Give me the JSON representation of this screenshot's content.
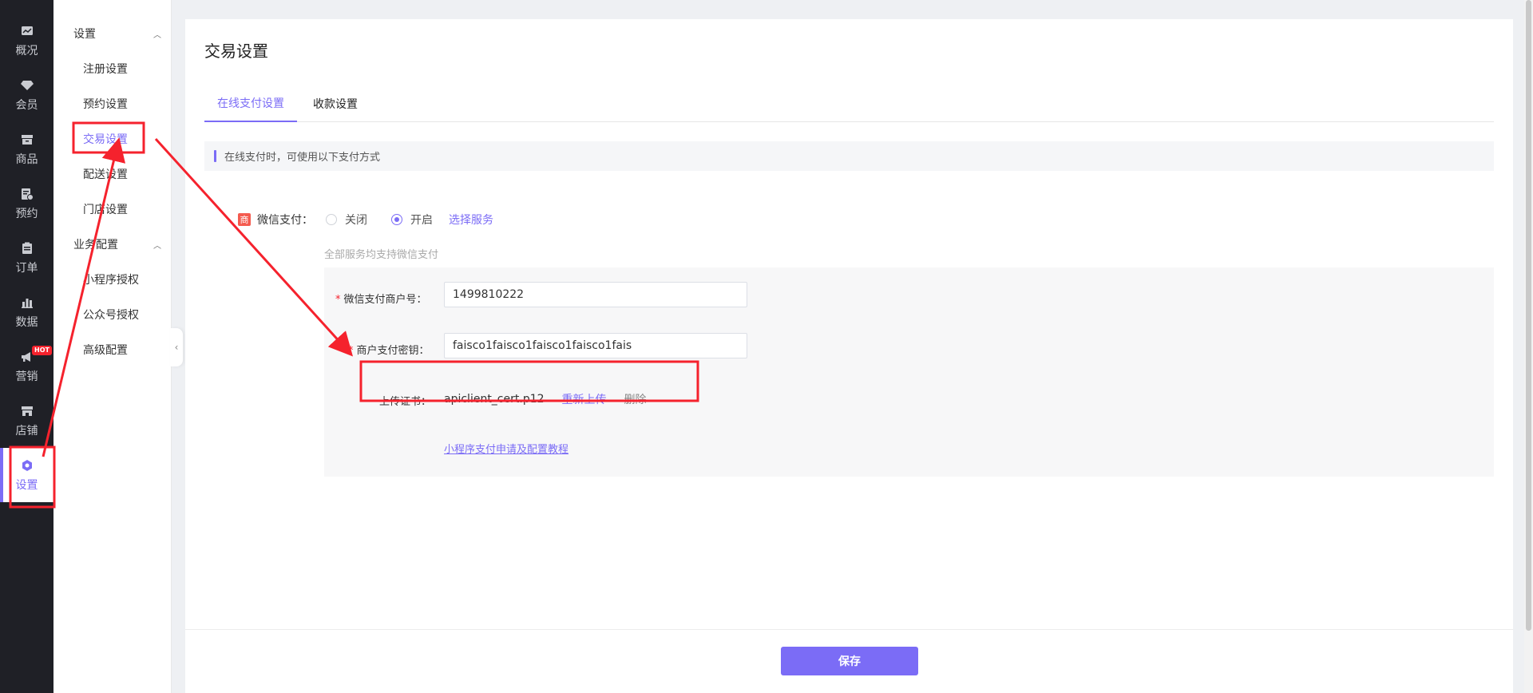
{
  "rail": {
    "items": [
      {
        "label": "概况",
        "icon": "overview-icon"
      },
      {
        "label": "会员",
        "icon": "member-icon"
      },
      {
        "label": "商品",
        "icon": "product-icon"
      },
      {
        "label": "预约",
        "icon": "booking-icon"
      },
      {
        "label": "订单",
        "icon": "order-icon"
      },
      {
        "label": "数据",
        "icon": "chart-icon"
      },
      {
        "label": "营销",
        "icon": "megaphone-icon",
        "badge": "HOT"
      },
      {
        "label": "店铺",
        "icon": "store-icon"
      },
      {
        "label": "设置",
        "icon": "gear-icon",
        "active": true
      }
    ]
  },
  "submenu": {
    "group1": {
      "title": "设置",
      "items": [
        "注册设置",
        "预约设置",
        "交易设置",
        "配送设置",
        "门店设置"
      ]
    },
    "group2": {
      "title": "业务配置",
      "items": [
        "小程序授权",
        "公众号授权",
        "高级配置"
      ]
    }
  },
  "main": {
    "title": "交易设置",
    "tabs": [
      "在线支付设置",
      "收款设置"
    ],
    "notice": "在线支付时，可使用以下支付方式",
    "wechat_pay": {
      "shang_glyph": "商",
      "label": "微信支付：",
      "option_off": "关闭",
      "option_on": "开启",
      "selected": "开启",
      "select_service": "选择服务",
      "hint": "全部服务均支持微信支付"
    },
    "fields": {
      "merchant_id_label": "微信支付商户号：",
      "merchant_id_value": "1499810222",
      "secret_label": "商户支付密钥：",
      "secret_value": "faisco1faisco1faisco1faisco1fais",
      "cert_label": "上传证书：",
      "cert_file": "apiclient_cert.p12",
      "reupload": "重新上传",
      "delete": "删除",
      "tutorial": "小程序支付申请及配置教程"
    },
    "save_label": "保存"
  },
  "colors": {
    "accent": "#7b6cf6",
    "rail_bg": "#1f2026",
    "annotation": "#f5222d"
  }
}
